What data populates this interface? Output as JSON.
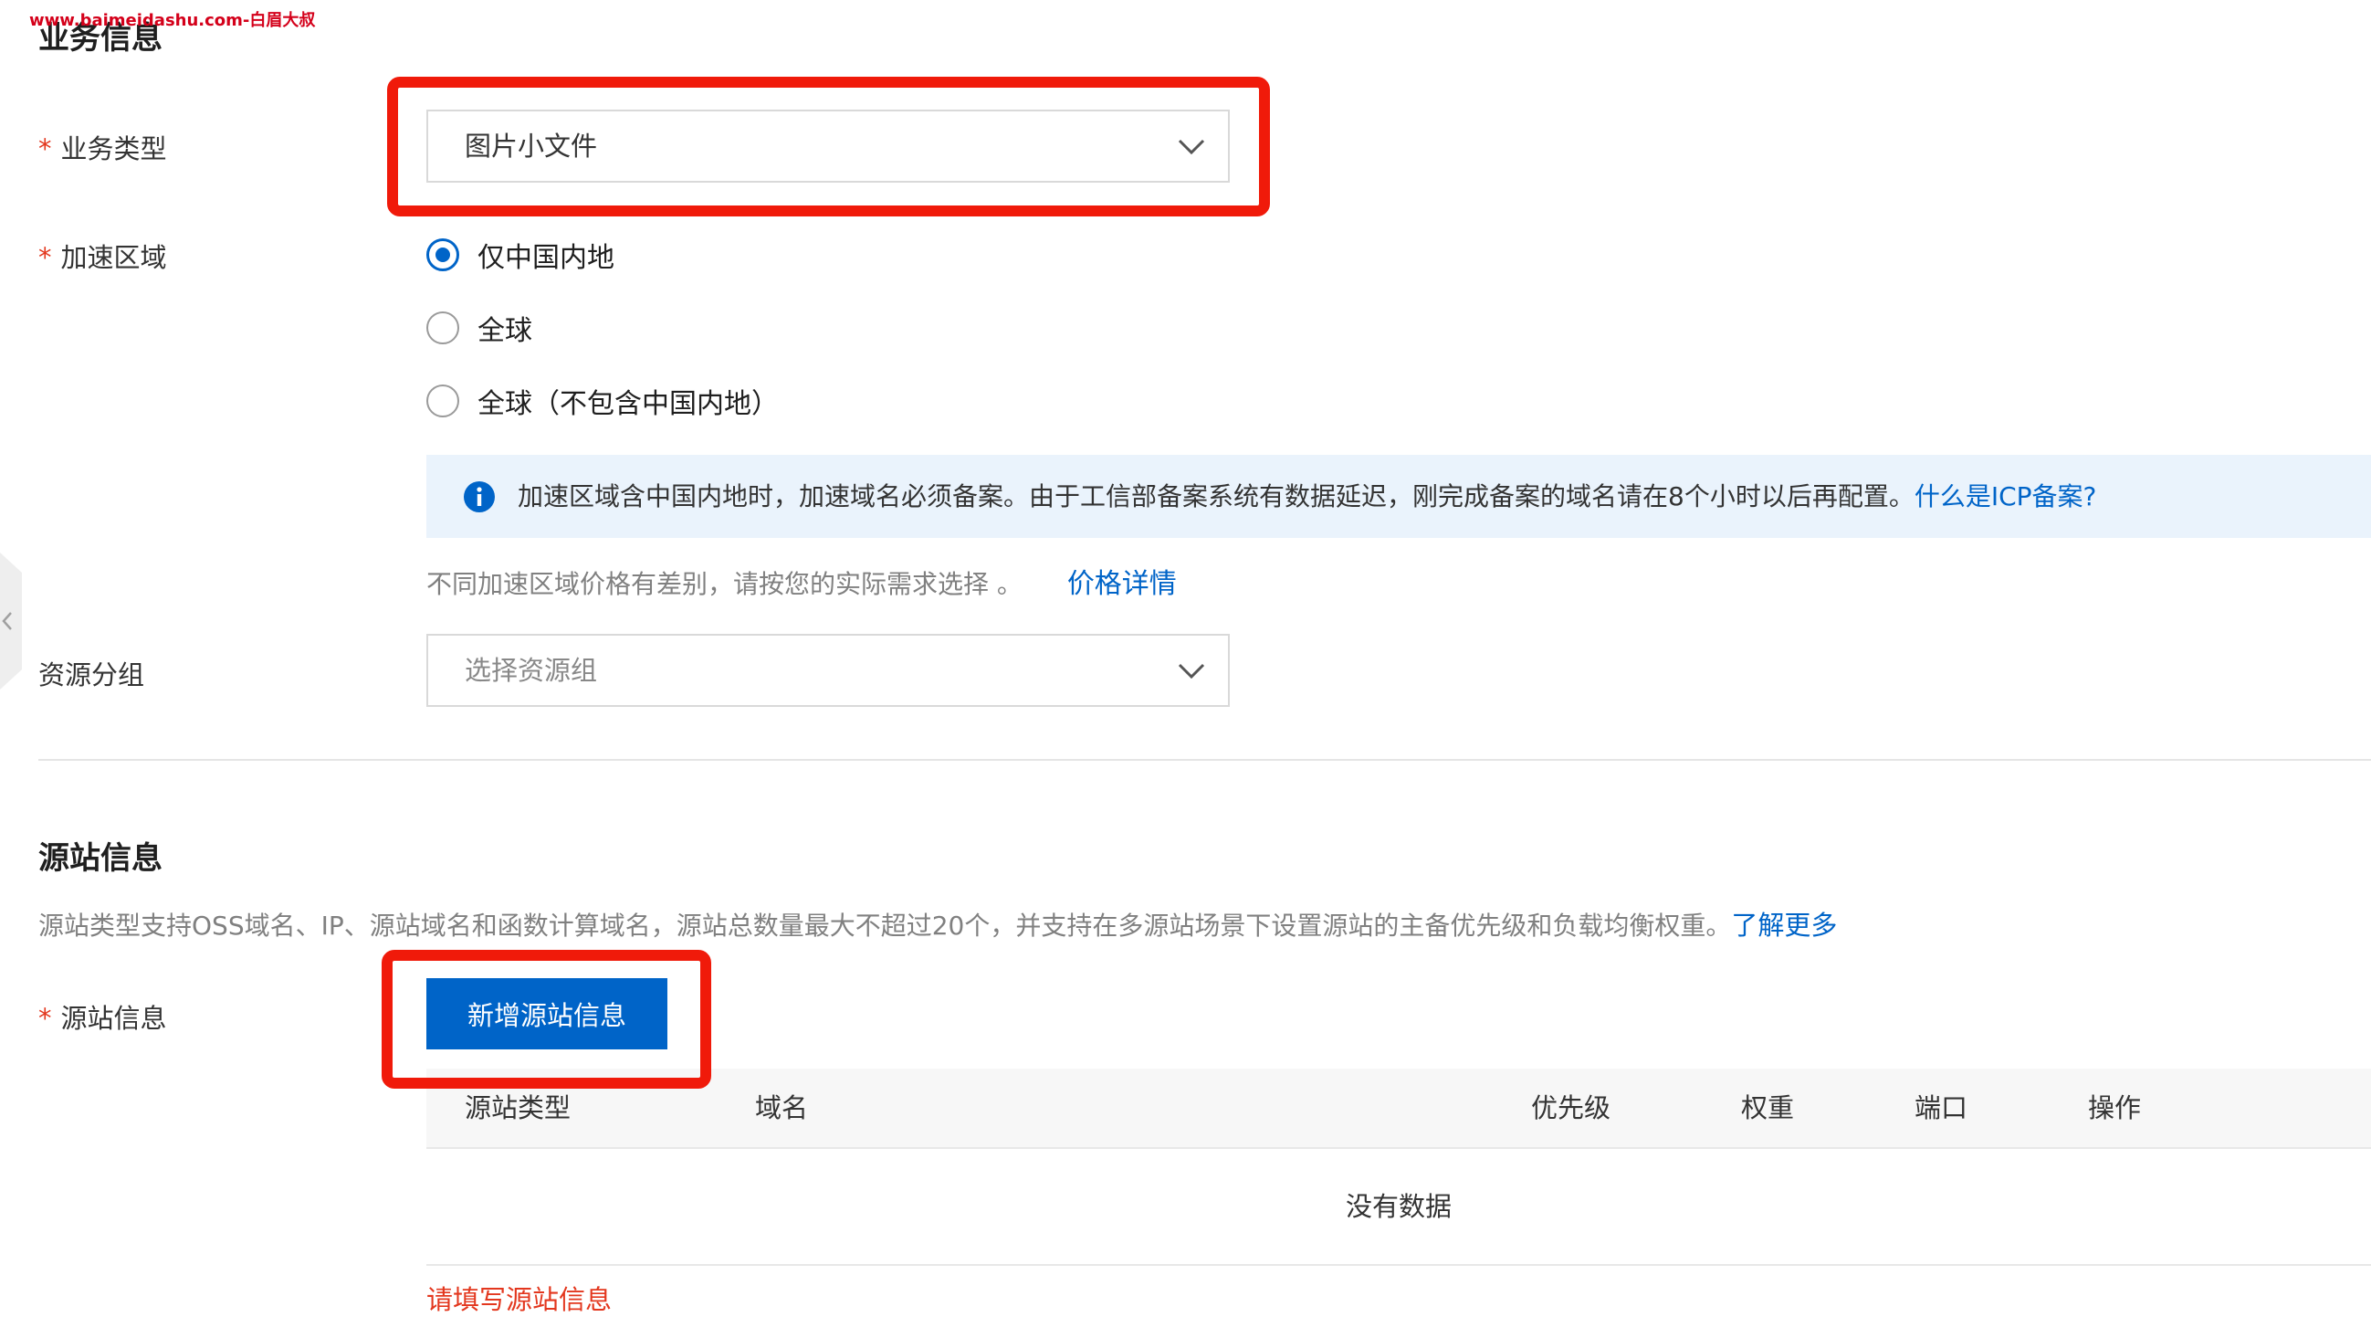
{
  "watermark": "www.baimeidashu.com-白眉大叔",
  "business": {
    "section_title": "业务信息",
    "type_label": "业务类型",
    "type_value": "图片小文件",
    "region_label": "加速区域",
    "region_options": [
      {
        "label": "仅中国内地",
        "checked": true
      },
      {
        "label": "全球",
        "checked": false
      },
      {
        "label": "全球（不包含中国内地）",
        "checked": false
      }
    ],
    "notice_text": "加速区域含中国内地时，加速域名必须备案。由于工信部备案系统有数据延迟，刚完成备案的域名请在8个小时以后再配置。",
    "notice_link": "什么是ICP备案?",
    "price_hint": "不同加速区域价格有差别，请按您的实际需求选择 。",
    "price_link": "价格详情",
    "resource_group_label": "资源分组",
    "resource_group_placeholder": "选择资源组"
  },
  "origin": {
    "section_title": "源站信息",
    "description": "源站类型支持OSS域名、IP、源站域名和函数计算域名，源站总数量最大不超过20个，并支持在多源站场景下设置源站的主备优先级和负载均衡权重。",
    "learn_more": "了解更多",
    "field_label": "源站信息",
    "add_button": "新增源站信息",
    "table": {
      "columns": [
        "源站类型",
        "域名",
        "优先级",
        "权重",
        "端口",
        "操作"
      ],
      "empty_text": "没有数据"
    },
    "error": "请填写源站信息"
  },
  "colors": {
    "primary": "#0064c8",
    "required_star": "#e3371e",
    "highlight_box": "#f01a0a",
    "notice_bg": "#eaf3fc"
  },
  "icons": [
    "chevron-down-icon",
    "info-icon",
    "chevron-left-icon"
  ]
}
